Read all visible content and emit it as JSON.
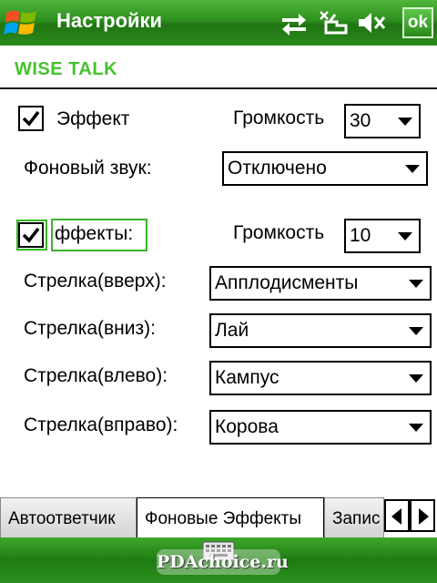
{
  "titlebar": {
    "title": "Настройки",
    "ok_label": "ok",
    "icons": [
      "windows-start-icon",
      "connectivity-arrows-icon",
      "no-signal-icon",
      "volume-muted-icon"
    ]
  },
  "app": {
    "title": "WISE TALK"
  },
  "effect": {
    "checked": true,
    "label": "Эффект",
    "volume_label": "Громкость",
    "volume_value": "30"
  },
  "background": {
    "label": "Фоновый звук:",
    "value": "Отключено"
  },
  "effects2": {
    "checked": true,
    "label": "ффекты:",
    "volume_label": "Громкость",
    "volume_value": "10"
  },
  "arrows": [
    {
      "label": "Стрелка(вверх):",
      "value": "Апплодисменты"
    },
    {
      "label": "Стрелка(вниз):",
      "value": "Лай"
    },
    {
      "label": "Стрелка(влево):",
      "value": "Кампус"
    },
    {
      "label": "Стрелка(вправо):",
      "value": "Корова"
    }
  ],
  "tabs": {
    "items": [
      "Автоответчик",
      "Фоновые Эффекты",
      "Запис"
    ],
    "active_index": 1
  },
  "softbar": {
    "watermark": "PDAchoice.ru"
  },
  "colors": {
    "accent_green": "#46c22f",
    "titlebar_green": "#2e8f1f",
    "focus_green": "#39b52a"
  }
}
